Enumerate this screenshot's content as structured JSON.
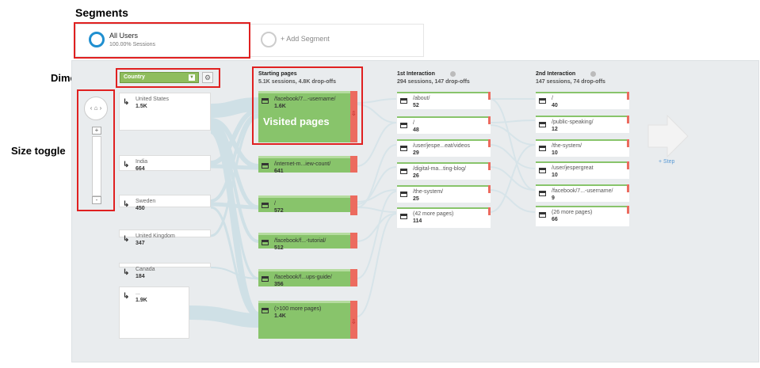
{
  "annotations": {
    "segments": "Segments",
    "dimension": "Dimension",
    "size_toggle": "Size toggle",
    "visited_pages": "Visited pages"
  },
  "segments": {
    "all_users_label": "All Users",
    "all_users_sub": "100.00% Sessions",
    "add_segment": "+ Add Segment",
    "colors": {
      "all_users_ring": "#1f8fd0"
    }
  },
  "dimension": {
    "selected": "Country",
    "icon": "gear-icon"
  },
  "zoom": {
    "home_icon": "home-icon",
    "plus": "+",
    "minus": "-"
  },
  "columns": {
    "starting": {
      "title": "Starting pages",
      "sub": "5.1K sessions, 4.8K drop-offs"
    },
    "first": {
      "title": "1st Interaction",
      "sub": "294 sessions, 147 drop-offs"
    },
    "second": {
      "title": "2nd Interaction",
      "sub": "147 sessions, 74 drop-offs"
    }
  },
  "countries": [
    {
      "name": "United States",
      "value": "1.5K"
    },
    {
      "name": "India",
      "value": "664"
    },
    {
      "name": "Sweden",
      "value": "450"
    },
    {
      "name": "United Kingdom",
      "value": "347"
    },
    {
      "name": "Canada",
      "value": "184"
    },
    {
      "name": "...",
      "value": "1.9K"
    }
  ],
  "starting_pages": [
    {
      "name": "/facebook/7...-username/",
      "value": "1.6K"
    },
    {
      "name": "/internet-m...iew-count/",
      "value": "641"
    },
    {
      "name": "/",
      "value": "572"
    },
    {
      "name": "/facebook/f...-tutorial/",
      "value": "512"
    },
    {
      "name": "/facebook/f...ups-guide/",
      "value": "356"
    },
    {
      "name": "(>100 more pages)",
      "value": "1.4K"
    }
  ],
  "first_interaction": [
    {
      "name": "/about/",
      "value": "52"
    },
    {
      "name": "/",
      "value": "48"
    },
    {
      "name": "/user/jespe...eat/videos",
      "value": "29"
    },
    {
      "name": "/digital-ma...ting-blog/",
      "value": "26"
    },
    {
      "name": "/the-system/",
      "value": "25"
    },
    {
      "name": "(42 more pages)",
      "value": "114"
    }
  ],
  "second_interaction": [
    {
      "name": "/",
      "value": "40"
    },
    {
      "name": "/public-speaking/",
      "value": "12"
    },
    {
      "name": "/the-system/",
      "value": "10"
    },
    {
      "name": "/user/jespergreat",
      "value": "10"
    },
    {
      "name": "/facebook/7...-username/",
      "value": "9"
    },
    {
      "name": "(26 more pages)",
      "value": "66"
    }
  ],
  "add_step": "+ Step",
  "colors": {
    "page_green": "#88c46b",
    "dropoff_red": "#ec6b5f",
    "annotation_red": "#e02020",
    "flow": "#cfe0e6"
  }
}
